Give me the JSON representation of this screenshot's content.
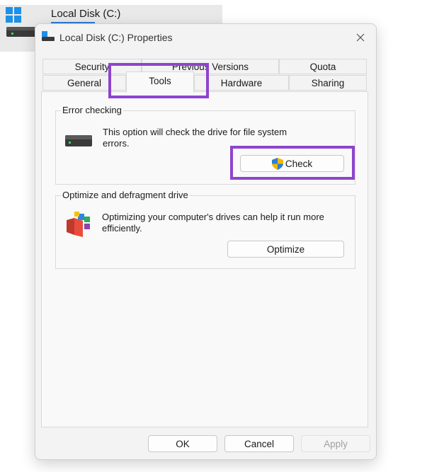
{
  "background_window": {
    "title": "Local Disk (C:)"
  },
  "dialog": {
    "title": "Local Disk (C:) Properties",
    "tabs_back": [
      "Security",
      "Previous Versions",
      "Quota"
    ],
    "tabs_front": [
      "General",
      "Tools",
      "Hardware",
      "Sharing"
    ],
    "active_tab": "Tools"
  },
  "error_checking": {
    "label": "Error checking",
    "description_line1": "This option will check the drive for file system",
    "description_line2": "errors.",
    "button": "Check"
  },
  "optimize": {
    "label": "Optimize and defragment drive",
    "description_line1": "Optimizing your computer's drives can help it run more",
    "description_line2": "efficiently.",
    "button": "Optimize"
  },
  "footer": {
    "ok": "OK",
    "cancel": "Cancel",
    "apply": "Apply"
  },
  "colors": {
    "highlight": "#8e44ce",
    "accent": "#2b7bd6"
  },
  "icons": [
    "windows-logo-icon",
    "drive-icon",
    "close-icon",
    "uac-shield-icon",
    "defrag-icon"
  ]
}
